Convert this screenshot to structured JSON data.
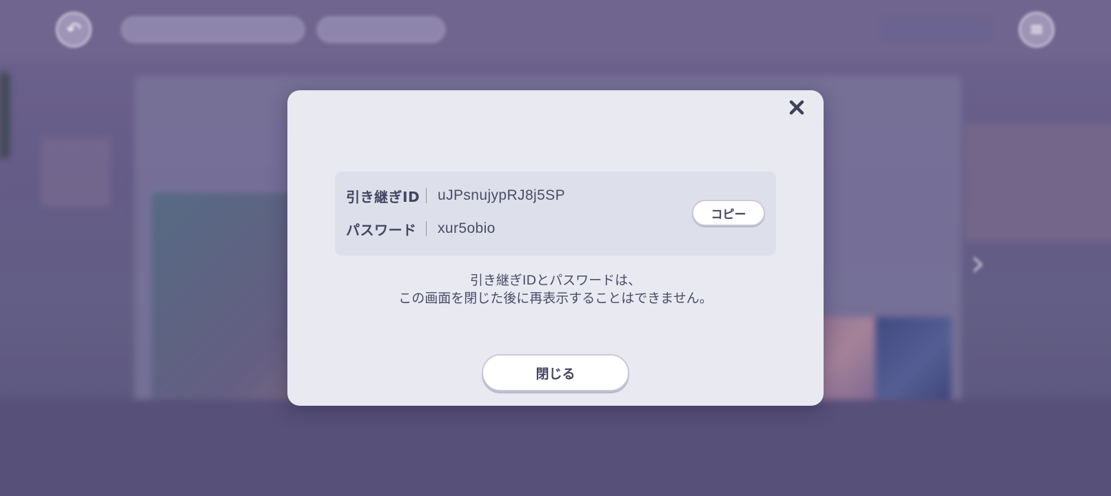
{
  "dialog": {
    "credentials": {
      "id_label": "引き継ぎID",
      "id_value": "uJPsnujypRJ8j5SP",
      "password_label": "パスワード",
      "password_value": "xur5obio",
      "copy_label": "コピー"
    },
    "notice_line1": "引き継ぎIDとパスワードは、",
    "notice_line2": "この画面を閉じた後に再表示することはできません。",
    "close_label": "閉じる"
  },
  "colors": {
    "modal_bg": "#e8e9f1",
    "panel_bg": "#dddfea",
    "text": "#444560",
    "backdrop": "#6f6790"
  },
  "icons": {
    "close": "close-icon",
    "back": "back-arrow-icon",
    "menu": "menu-icon",
    "next": "chevron-right-icon"
  }
}
